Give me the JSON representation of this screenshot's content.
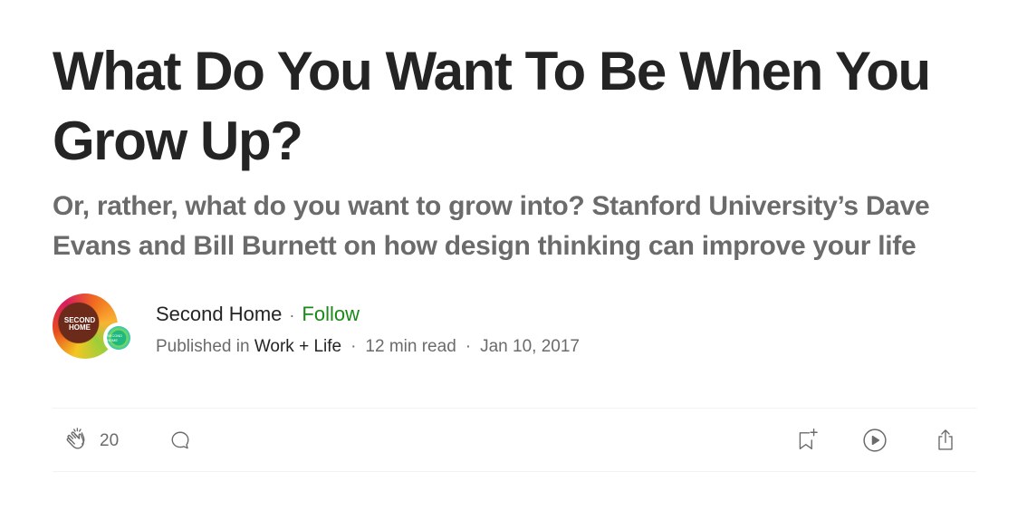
{
  "article": {
    "title": "What Do You Want To Be When You Grow Up?",
    "subtitle": "Or, rather, what do you want to grow into? Stanford University’s Dave Evans and Bill Burnett on how design thinking can improve your life"
  },
  "author": {
    "name": "Second Home",
    "separator": "·",
    "follow_label": "Follow",
    "avatar_text": "SECOND HOME",
    "publication_badge_text": "SECOND HOME"
  },
  "meta": {
    "published_in_label": "Published in",
    "publication": "Work + Life",
    "separator": "·",
    "read_time": "12 min read",
    "date": "Jan 10, 2017"
  },
  "actions": {
    "clap_count": "20",
    "icons": {
      "clap": "clap-icon",
      "comment": "comment-icon",
      "save": "bookmark-add-icon",
      "listen": "play-circle-icon",
      "share": "share-icon"
    }
  },
  "colors": {
    "follow": "#1a8917",
    "text": "#242424",
    "muted": "#6b6b6b",
    "divider": "#f2f2f2"
  }
}
